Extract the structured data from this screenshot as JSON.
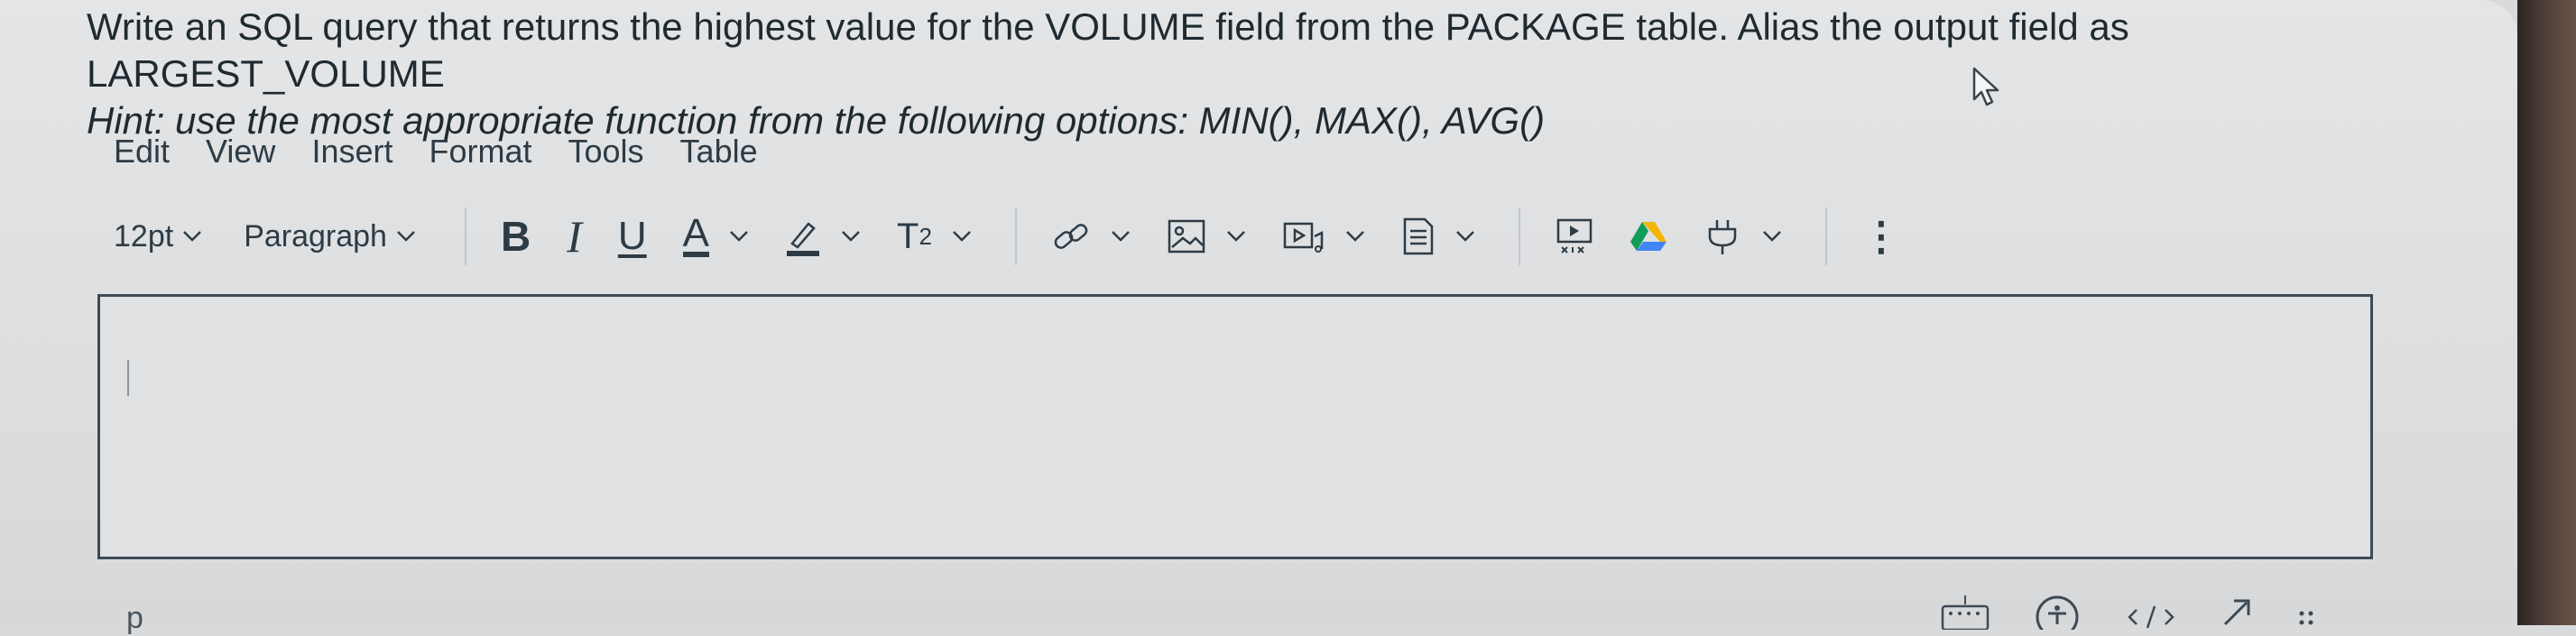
{
  "question": {
    "text": "Write an SQL query that returns the highest value for the VOLUME field from the PACKAGE table. Alias the output field as LARGEST_VOLUME",
    "hint": "Hint: use the most appropriate function from the following options: MIN(), MAX(), AVG()"
  },
  "menubar": {
    "items": [
      "Edit",
      "View",
      "Insert",
      "Format",
      "Tools",
      "Table"
    ]
  },
  "toolbar": {
    "font_size": "12pt",
    "block_format": "Paragraph",
    "bold_label": "B",
    "italic_label": "I",
    "underline_label": "U",
    "text_color_label": "A",
    "superscript_label": "T",
    "superscript_exp": "2",
    "more_label": "⋮"
  },
  "editor": {
    "value": ""
  },
  "statusbar": {
    "path": "p"
  },
  "colors": {
    "text": "#2d3b45",
    "accent_google_drive_yellow": "#f4b400",
    "accent_google_drive_green": "#0f9d58",
    "accent_google_drive_blue": "#4285f4"
  },
  "icons": [
    "chevron-down-icon",
    "highlighter-icon",
    "link-icon",
    "image-icon",
    "media-icon",
    "document-icon",
    "apps-icon",
    "google-drive-icon",
    "plugin-icon",
    "more-icon",
    "keyboard-icon",
    "accessibility-icon",
    "html-icon",
    "resize-icon"
  ]
}
